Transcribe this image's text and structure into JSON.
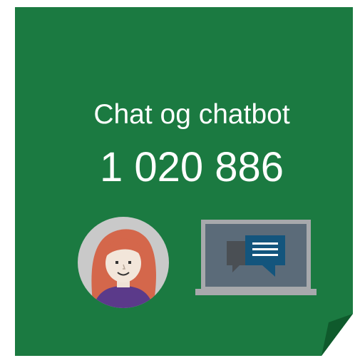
{
  "card": {
    "title": "Chat og chatbot",
    "count": "1 020 886"
  },
  "colors": {
    "background": "#1b7a41",
    "fold": "#136132",
    "text": "#ffffff"
  },
  "icons": {
    "avatar": "person-avatar-icon",
    "laptop": "laptop-chat-icon"
  }
}
